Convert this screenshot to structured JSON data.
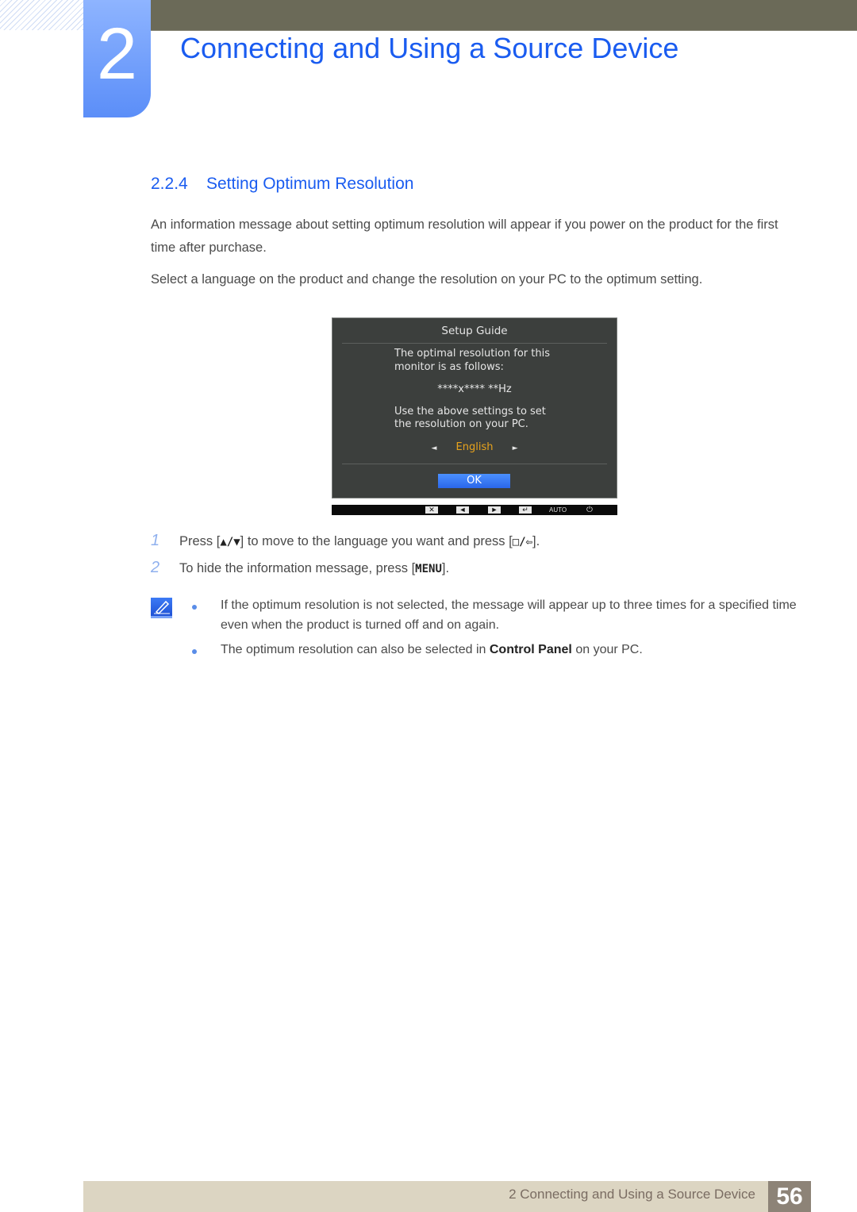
{
  "header": {
    "chapter_number": "2",
    "chapter_title": "Connecting and Using a Source Device"
  },
  "section": {
    "number": "2.2.4",
    "title": "Setting Optimum Resolution"
  },
  "paragraphs": [
    "An information message about setting optimum resolution will appear if you power on the product for the first time after purchase.",
    "Select a language on the product and change the resolution on your PC to the optimum setting."
  ],
  "osd": {
    "title": "Setup Guide",
    "line1": "The optimal resolution for this",
    "line2": "monitor is as follows:",
    "resolution": "****x****  **Hz",
    "line3": "Use the above settings to set",
    "line4": "the resolution on your PC.",
    "language": "English",
    "left_arrow": "◄",
    "right_arrow": "►",
    "ok_label": "OK",
    "buttons": {
      "close": "✕",
      "left": "◄",
      "right": "►",
      "enter": "↵",
      "auto": "AUTO",
      "power": "⏻"
    }
  },
  "steps": [
    {
      "num": "1",
      "pre": "Press [",
      "key": "▲/▼",
      "mid": "] to move to the language you want and press [",
      "key2": "□/⇦",
      "post": "]."
    },
    {
      "num": "2",
      "pre": "To hide the information message, press [",
      "key": "MENU",
      "post": "]."
    }
  ],
  "notes": [
    {
      "text": "If the optimum resolution is not selected, the message will appear up to three times for a specified time even when the product is turned off and on again."
    },
    {
      "pre": "The optimum resolution can also be selected in ",
      "bold": "Control Panel",
      "post": " on your PC."
    }
  ],
  "footer": {
    "text": "2 Connecting and Using a Source Device",
    "page": "56"
  }
}
